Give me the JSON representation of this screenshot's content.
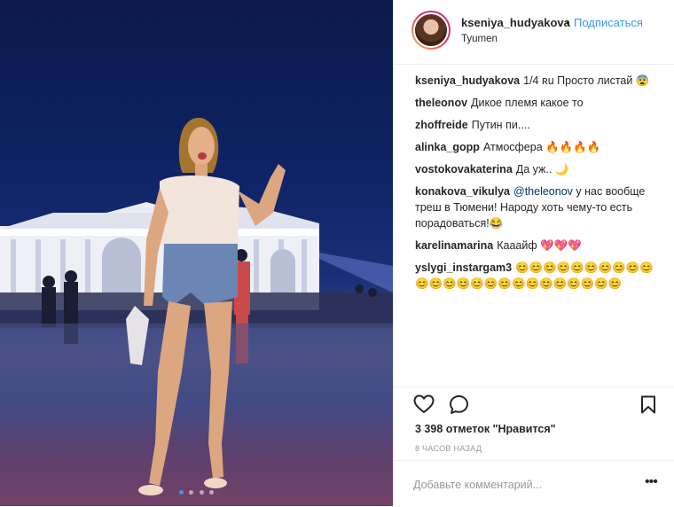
{
  "post": {
    "username": "kseniya_hudyakova",
    "separator": "•",
    "follow_label": "Подписаться",
    "location": "Tyumen",
    "comments": [
      {
        "user": "kseniya_hudyakova",
        "text": "1/4 ʀu Просто листай 😨"
      },
      {
        "user": "theleonov",
        "text": "Дикое племя какое то"
      },
      {
        "user": "zhoffreide",
        "text": "Путин пи...."
      },
      {
        "user": "alinka_gopp",
        "text": "Атмосфера 🔥🔥🔥🔥"
      },
      {
        "user": "vostokovakaterina",
        "text": "Да уж.. 🌙"
      },
      {
        "user": "konakova_vikulya",
        "mention": "@theleonov",
        "text": " у нас вообще треш в Тюмени! Народу хоть чему-то есть порадоваться!😂"
      },
      {
        "user": "karelinamarina",
        "text": "Кааайф 💖💖💖"
      },
      {
        "user": "yslygi_instargam3",
        "text": "😊😊😊😊😊😊😊😊😊😊😊😊😊😊😊😊😊😊😊😊😊😊😊😊😊"
      }
    ],
    "likes": "3 398 отметок \"Нравится\"",
    "time_ago": "8 ЧАСОВ НАЗАД",
    "add_comment_placeholder": "Добавьте комментарий...",
    "more_label": "•••",
    "carousel": {
      "count": 4,
      "active": 1
    }
  },
  "icons": {
    "like": "heart-icon",
    "comment": "comment-bubble-icon",
    "save": "bookmark-icon",
    "more": "more-options-icon"
  },
  "colors": {
    "link": "#3897f0",
    "text": "#262626",
    "muted": "#999999",
    "border": "#efefef"
  }
}
